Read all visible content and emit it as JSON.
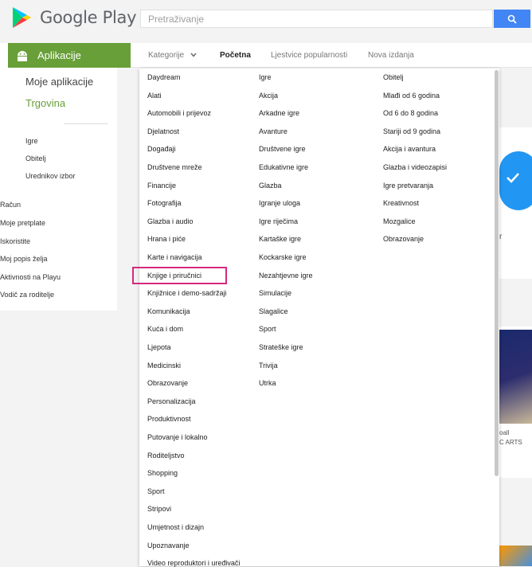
{
  "header": {
    "brand": "Google Play",
    "search_placeholder": "Pretraživanje"
  },
  "sidebar": {
    "section_title": "Aplikacije",
    "my_apps": "Moje aplikacije",
    "store": "Trgovina",
    "sub_items": [
      "Igre",
      "Obitelj",
      "Urednikov izbor"
    ],
    "account_items": [
      "Račun",
      "Moje pretplate",
      "Iskoristite",
      "Moj popis želja",
      "Aktivnosti na Playu",
      "Vodič za roditelje"
    ]
  },
  "subnav": {
    "categories": "Kategorije",
    "home": "Početna",
    "top_charts": "Ljestvice popularnosti",
    "new_releases": "Nova izdanja"
  },
  "dropdown": {
    "apps": [
      "Daydream",
      "Alati",
      "Automobili i prijevoz",
      "Djelatnost",
      "Događaji",
      "Društvene mreže",
      "Financije",
      "Fotografija",
      "Glazba i audio",
      "Hrana i piće",
      "Karte i navigacija",
      "Knjige i priručnici",
      "Knjižnice i demo-sadržaji",
      "Komunikacija",
      "Kuća i dom",
      "Ljepota",
      "Medicinski",
      "Obrazovanje",
      "Personalizacija",
      "Produktivnost",
      "Putovanje i lokalno",
      "Roditeljstvo",
      "Shopping",
      "Sport",
      "Stripovi",
      "Umjetnost i dizajn",
      "Upoznavanje",
      "Video reproduktori i uređivači"
    ],
    "games": [
      "Igre",
      "Akcija",
      "Arkadne igre",
      "Avanture",
      "Društvene igre",
      "Edukativne igre",
      "Glazba",
      "Igranje uloga",
      "Igre riječima",
      "Kartaške igre",
      "Kockarske igre",
      "Nezahtjevne igre",
      "Simulacije",
      "Slagalice",
      "Sport",
      "Strateške igre",
      "Trivija",
      "Utrka"
    ],
    "family": [
      "Obitelj",
      "Mlađi od 6 godina",
      "Od 6 do 8 godina",
      "Stariji od 9 godina",
      "Akcija i avantura",
      "Glazba i videozapisi",
      "Igre pretvaranja",
      "Kreativnost",
      "Mozgalice",
      "Obrazovanje"
    ]
  },
  "background": {
    "partial_text_1": "r",
    "partial_text_2": "oall",
    "partial_text_3": "C ARTS"
  },
  "colors": {
    "apps_green": "#689f38",
    "store_green": "#689f38",
    "search_blue": "#4285f4",
    "highlight": "#d6297c"
  }
}
